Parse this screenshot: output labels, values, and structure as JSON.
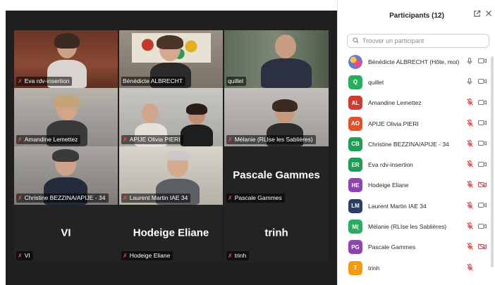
{
  "participants_panel": {
    "title": "Participants (12)",
    "search_placeholder": "Trouver un participant",
    "participants": [
      {
        "initials": "",
        "name": "Bénédicte ALBRECHT (Hôte, moi)",
        "color": "#3d6fb5",
        "mic": "on",
        "camera": "on"
      },
      {
        "initials": "Q",
        "name": "quillet",
        "color": "#27ae60",
        "mic": "on",
        "camera": "on"
      },
      {
        "initials": "AL",
        "name": "Amandine Lemettez",
        "color": "#d03b2f",
        "mic": "off",
        "camera": "on"
      },
      {
        "initials": "AO",
        "name": "APIJE Olivia PIERI",
        "color": "#e0522a",
        "mic": "off",
        "camera": "on"
      },
      {
        "initials": "CB",
        "name": "Christine BEZZINA/APIJE - 34",
        "color": "#1f9d55",
        "mic": "off",
        "camera": "on"
      },
      {
        "initials": "ER",
        "name": "Eva rdv-insertion",
        "color": "#1f9d55",
        "mic": "off",
        "camera": "on"
      },
      {
        "initials": "HE",
        "name": "Hodeige Eliane",
        "color": "#8e44ad",
        "mic": "off",
        "camera": "off"
      },
      {
        "initials": "LM",
        "name": "Laurent Martin IAE 34",
        "color": "#2c3e66",
        "mic": "off",
        "camera": "on"
      },
      {
        "initials": "M(",
        "name": "Mélanie (RLIse les Sablières)",
        "color": "#27ae60",
        "mic": "off",
        "camera": "on"
      },
      {
        "initials": "PG",
        "name": "Pascale Gammes",
        "color": "#8e44ad",
        "mic": "off",
        "camera": "off"
      },
      {
        "initials": "T",
        "name": "trinh",
        "color": "#f39c12",
        "mic": "off",
        "camera": ""
      }
    ]
  },
  "video_tiles": [
    {
      "label": "Eva rdv-insertion",
      "mic_muted": true,
      "video": true,
      "bg": "#7a3a2a"
    },
    {
      "label": "Bénédicte ALBRECHT",
      "mic_muted": false,
      "video": true,
      "bg": "#8d8277"
    },
    {
      "label": "quillet",
      "mic_muted": false,
      "video": true,
      "bg": "#6f7a6a",
      "active": true
    },
    {
      "label": "Amandine Lemettez",
      "mic_muted": true,
      "video": true,
      "bg": "#9a9590"
    },
    {
      "label": "APIJE Olivia PIERI",
      "mic_muted": true,
      "video": true,
      "bg": "#b8b6b0"
    },
    {
      "label": "Mélanie (RLIse les Sablières)",
      "mic_muted": true,
      "video": true,
      "bg": "#a8a6a4"
    },
    {
      "label": "Christine BEZZINA/APIJE - 34",
      "mic_muted": true,
      "video": true,
      "bg": "#8c8a88"
    },
    {
      "label": "Laurent Martin IAE 34",
      "mic_muted": true,
      "video": true,
      "bg": "#c8c4bc"
    },
    {
      "label": "Pascale Gammes",
      "mic_muted": true,
      "video": false,
      "display_name": "Pascale Gammes"
    },
    {
      "label": "VI",
      "mic_muted": true,
      "video": false,
      "display_name": "VI"
    },
    {
      "label": "Hodeige Eliane",
      "mic_muted": true,
      "video": false,
      "display_name": "Hodeige Eliane"
    },
    {
      "label": "trinh",
      "mic_muted": true,
      "video": false,
      "display_name": "trinh"
    }
  ],
  "colors": {
    "video_background": "#1f1f1f",
    "active_speaker_border": "#2fb66b",
    "muted_red": "#e23b3b"
  },
  "icons": {
    "popout": "popout-icon",
    "close": "close-icon",
    "search": "search-icon",
    "mic": "microphone-icon",
    "mic_muted": "microphone-muted-icon",
    "camera": "camera-icon",
    "camera_off": "camera-off-icon"
  }
}
